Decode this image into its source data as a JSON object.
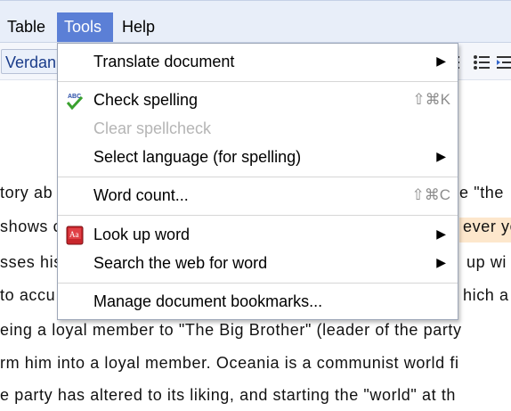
{
  "menubar": {
    "items": [
      {
        "label": "Table"
      },
      {
        "label": "Tools"
      },
      {
        "label": "Help"
      }
    ]
  },
  "toolbar": {
    "font_name": "Verdan",
    "icons": [
      "list-icon",
      "bullet-list-icon",
      "indent-icon"
    ]
  },
  "document": {
    "lines": [
      {
        "left": "tory ab",
        "right": "e \"the"
      },
      {
        "left": "shows c",
        "right": "ever yo"
      },
      {
        "left": "sses his",
        "right": "up wi"
      },
      {
        "left": "to accu",
        "right": "hich a"
      },
      {
        "full": "eing a loyal member to \"The Big Brother\" (leader of the party"
      },
      {
        "full": "rm him into a loyal member. Oceania is a communist world fi"
      },
      {
        "full": "e party has altered to its liking, and starting the \"world\" at th"
      }
    ]
  },
  "tools_menu": {
    "translate": "Translate document",
    "check_spelling": "Check spelling",
    "check_spelling_shortcut": "⇧⌘K",
    "clear_spellcheck": "Clear spellcheck",
    "select_language": "Select language (for spelling)",
    "word_count": "Word count...",
    "word_count_shortcut": "⇧⌘C",
    "look_up_word": "Look up word",
    "search_web": "Search the web for word",
    "manage_bookmarks": "Manage document bookmarks...",
    "submenu_arrow": "▶",
    "spellcheck_icon_text": "ABC",
    "dictionary_icon_text": "Aa"
  },
  "colors": {
    "menubar_bg": "#e8eef9",
    "active_menu": "#5b7fd6",
    "highlight": "#fde7cc"
  }
}
